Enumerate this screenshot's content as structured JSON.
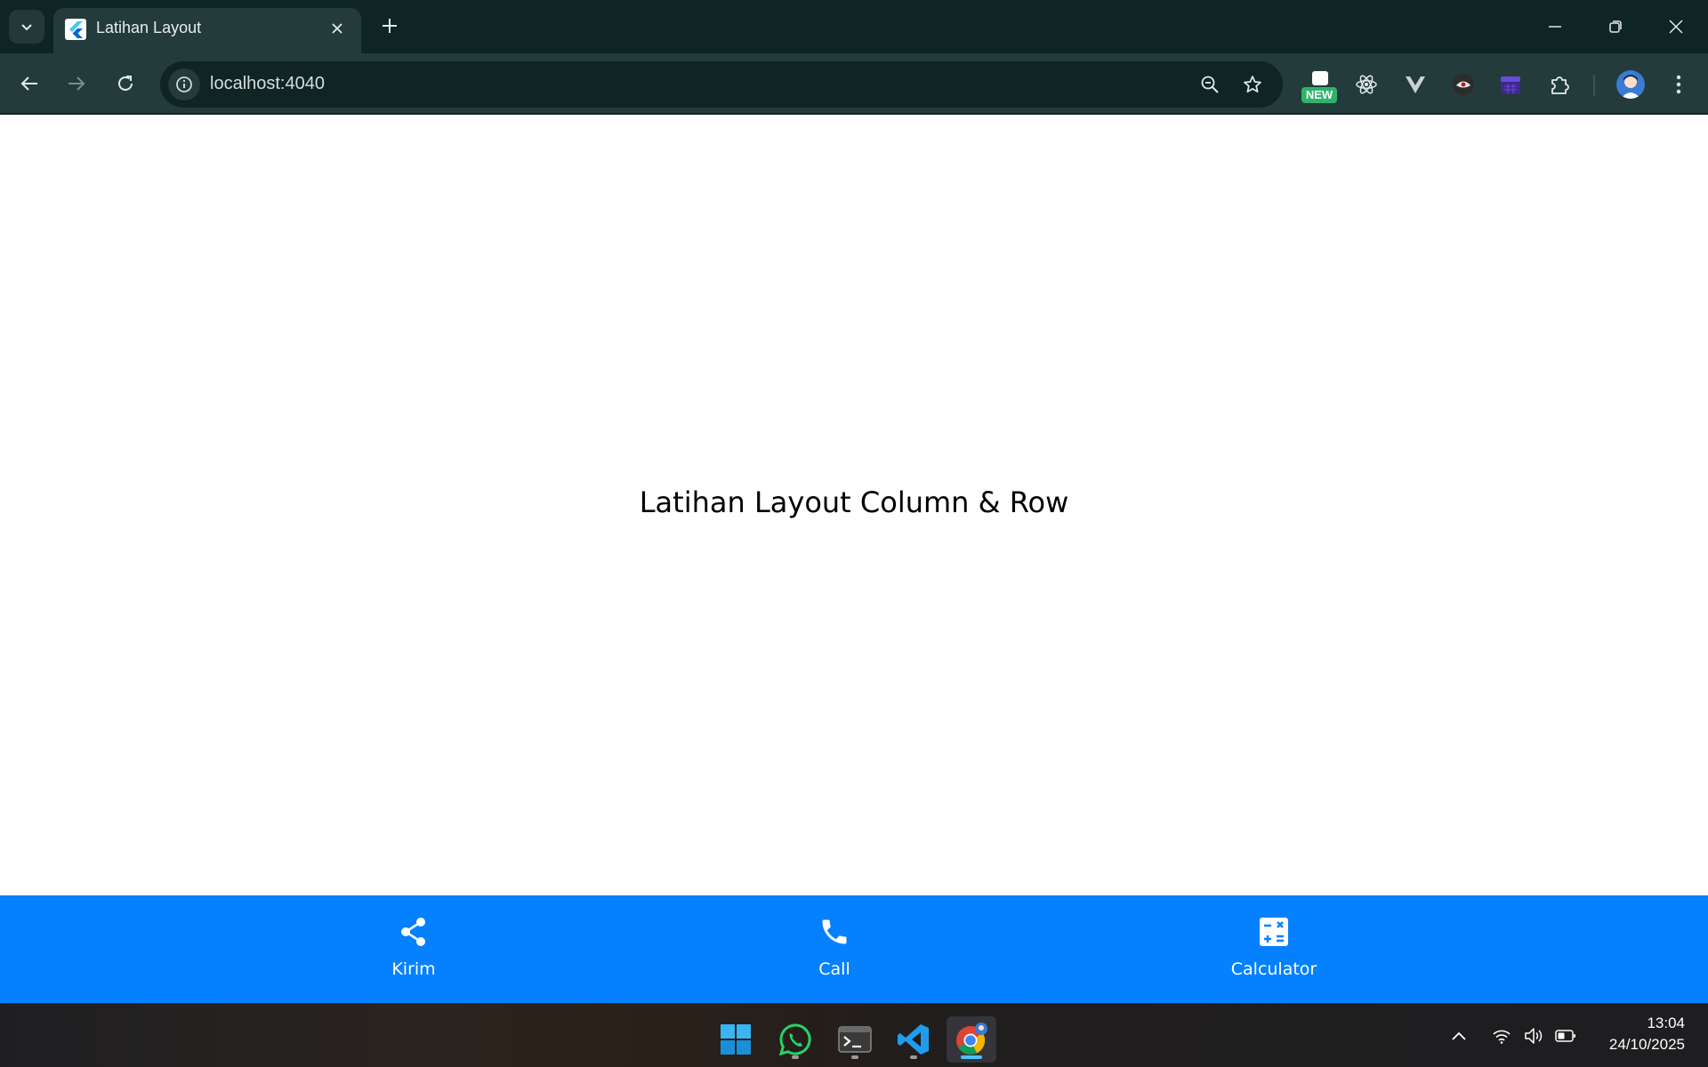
{
  "browser": {
    "tab": {
      "title": "Latihan Layout"
    },
    "address_bar": {
      "url": "localhost:4040"
    },
    "extensions": [
      {
        "name": "new-badge-extension",
        "badge": "NEW"
      },
      {
        "name": "react-devtools-icon"
      },
      {
        "name": "vue-devtools-icon"
      },
      {
        "name": "extension-icon"
      },
      {
        "name": "calendar-extension-icon"
      },
      {
        "name": "extensions-puzzle-icon"
      }
    ]
  },
  "app": {
    "heading": "Latihan Layout Column & Row",
    "bottom_nav": [
      {
        "icon": "share-icon",
        "label": "Kirim"
      },
      {
        "icon": "phone-icon",
        "label": "Call"
      },
      {
        "icon": "calculator-icon",
        "label": "Calculator"
      }
    ],
    "colors": {
      "nav_background": "#0580ff",
      "nav_foreground": "#ffffff"
    }
  },
  "taskbar": {
    "apps": [
      {
        "name": "windows-start-icon"
      },
      {
        "name": "whatsapp-icon"
      },
      {
        "name": "terminal-icon"
      },
      {
        "name": "vscode-icon"
      },
      {
        "name": "chrome-icon",
        "active": true
      }
    ],
    "clock": {
      "time": "13:04",
      "date": "24/10/2025"
    }
  }
}
